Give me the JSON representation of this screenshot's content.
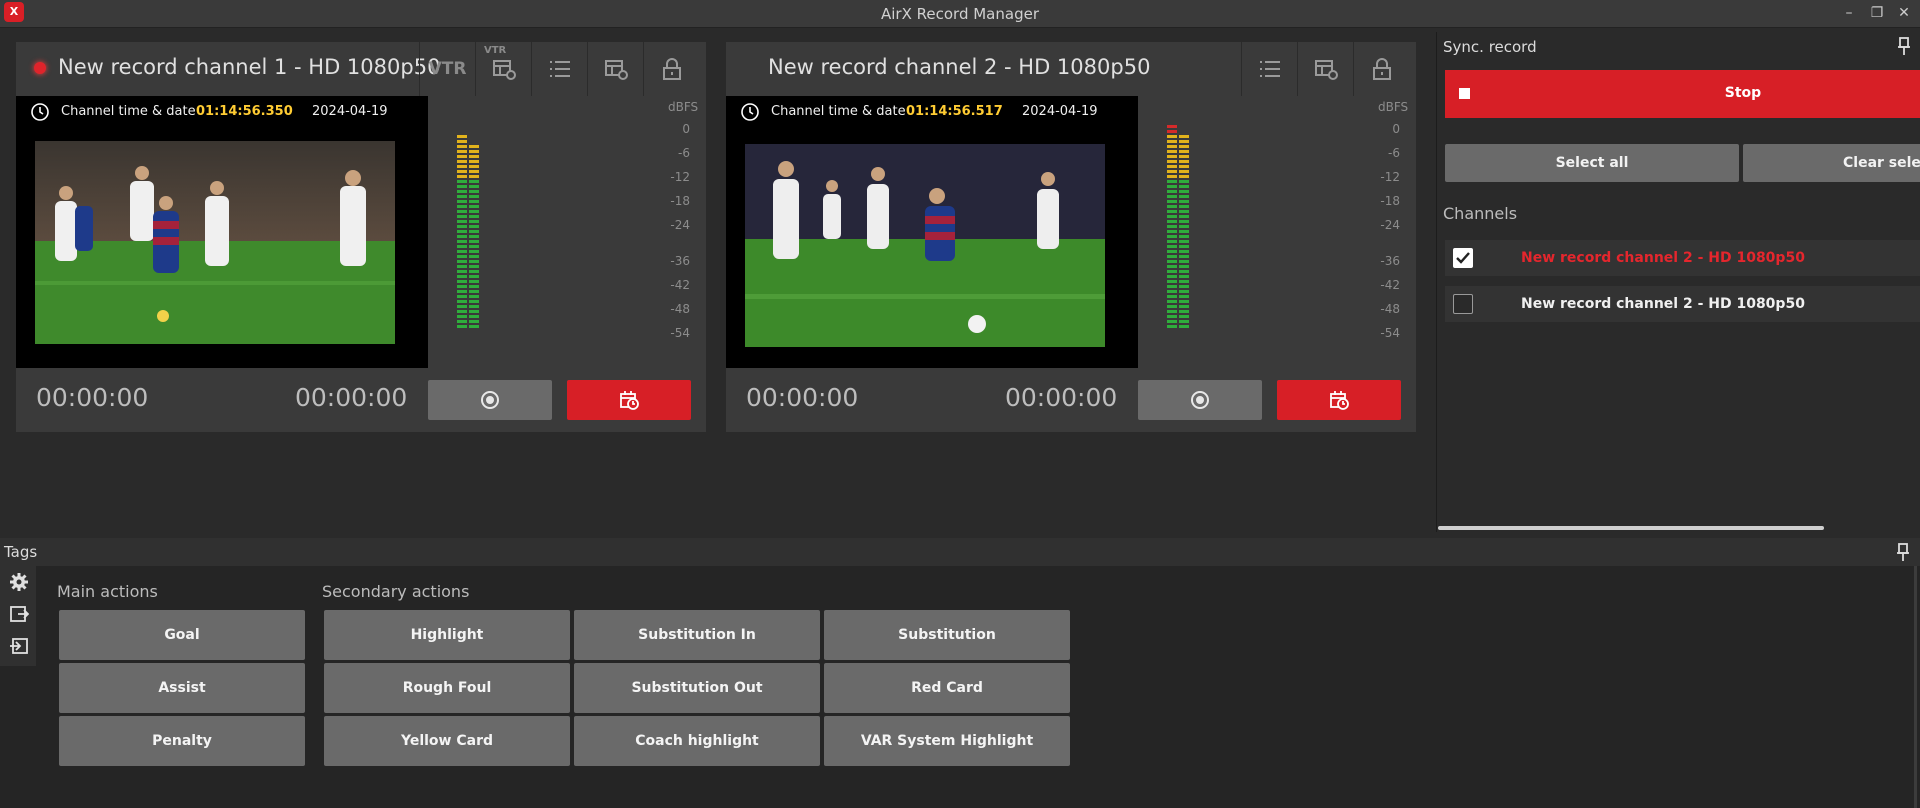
{
  "window": {
    "title": "AirX Record Manager",
    "logo_text": "X",
    "minimize_glyph": "–",
    "restore_glyph": "❐",
    "close_glyph": "✕"
  },
  "channels": [
    {
      "title": "New record channel 1 - HD 1080p50",
      "recording": true,
      "vtr_label": "VTR",
      "vtr_small_label": "VTR",
      "time_label": "Channel time & date",
      "time": "01:14:56.350",
      "date": "2024-04-19",
      "timecode_left": "00:00:00",
      "timecode_right": "00:00:00",
      "dbfs_label": "dBFS",
      "meter_levels": [
        0.9,
        0.86
      ]
    },
    {
      "title": "New record channel 2 - HD 1080p50",
      "recording": false,
      "time_label": "Channel time & date",
      "time": "01:14:56.517",
      "date": "2024-04-19",
      "timecode_left": "00:00:00",
      "timecode_right": "00:00:00",
      "dbfs_label": "dBFS",
      "meter_levels": [
        0.94,
        0.9
      ]
    }
  ],
  "db_scale": [
    "0",
    "-6",
    "-12",
    "-18",
    "-24",
    "-36",
    "-42",
    "-48",
    "-54"
  ],
  "sync": {
    "title": "Sync. record",
    "stop_label": "Stop",
    "select_all_label": "Select all",
    "clear_selection_label": "Clear selecti",
    "channels_label": "Channels",
    "rows": [
      {
        "label": "New record channel 2 - HD 1080p50",
        "checked": true,
        "color": "#e5262d"
      },
      {
        "label": "New record channel 2 - HD 1080p50",
        "checked": false,
        "color": "#f0f0f0"
      }
    ]
  },
  "tags": {
    "title": "Tags",
    "main_label": "Main actions",
    "secondary_label": "Secondary actions",
    "main_actions": [
      "Goal",
      "Assist",
      "Penalty"
    ],
    "secondary_actions": [
      "Highlight",
      "Substitution In",
      "Substitution",
      "Rough Foul",
      "Substitution Out",
      "Red Card",
      "Yellow Card",
      "Coach highlight",
      "VAR System Highlight"
    ]
  },
  "colors": {
    "accent_red": "#d71f26",
    "time_yellow": "#ffcc33",
    "button_gray": "#6a6a6a"
  }
}
